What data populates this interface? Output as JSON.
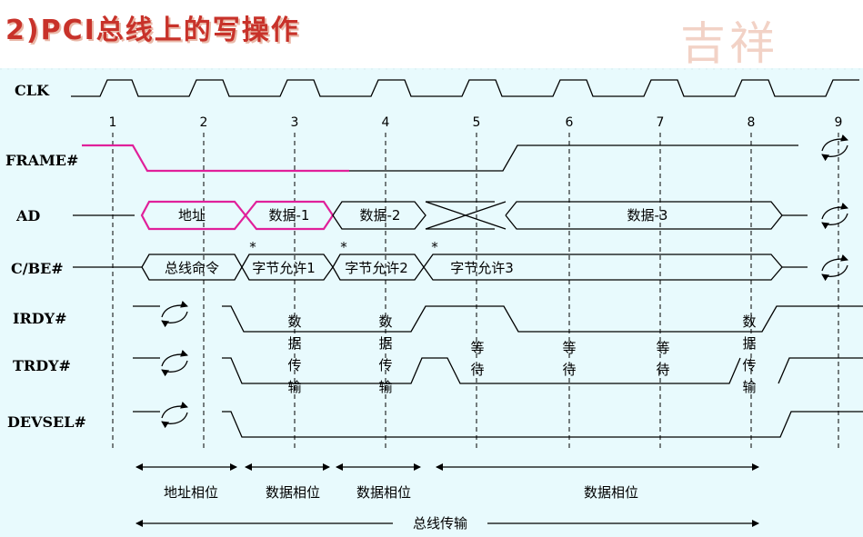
{
  "title": "2)PCI总线上的写操作",
  "stamp_text": "吉祥",
  "signals": {
    "clk": "CLK",
    "frame": "FRAME#",
    "ad": "AD",
    "cbe": "C/BE#",
    "irdy": "IRDY#",
    "trdy": "TRDY#",
    "devsel": "DEVSEL#"
  },
  "clock_numbers": [
    "1",
    "2",
    "3",
    "4",
    "5",
    "6",
    "7",
    "8",
    "9"
  ],
  "ad_boxes": [
    "地址",
    "数据-1",
    "数据-2",
    "数据-3"
  ],
  "cbe_boxes": [
    "总线命令",
    "字节允许1",
    "字节允许2",
    "字节允许3"
  ],
  "asterisk": "*",
  "transfer_chars": [
    "数",
    "据",
    "传",
    "输"
  ],
  "wait_chars": [
    "等",
    "待"
  ],
  "phases": [
    "地址相位",
    "数据相位",
    "数据相位",
    "数据相位"
  ],
  "bus_transfer": "总线传输",
  "colors": {
    "highlight": "#e0209a",
    "title": "#c8322a",
    "panel": "#e8fafd"
  }
}
